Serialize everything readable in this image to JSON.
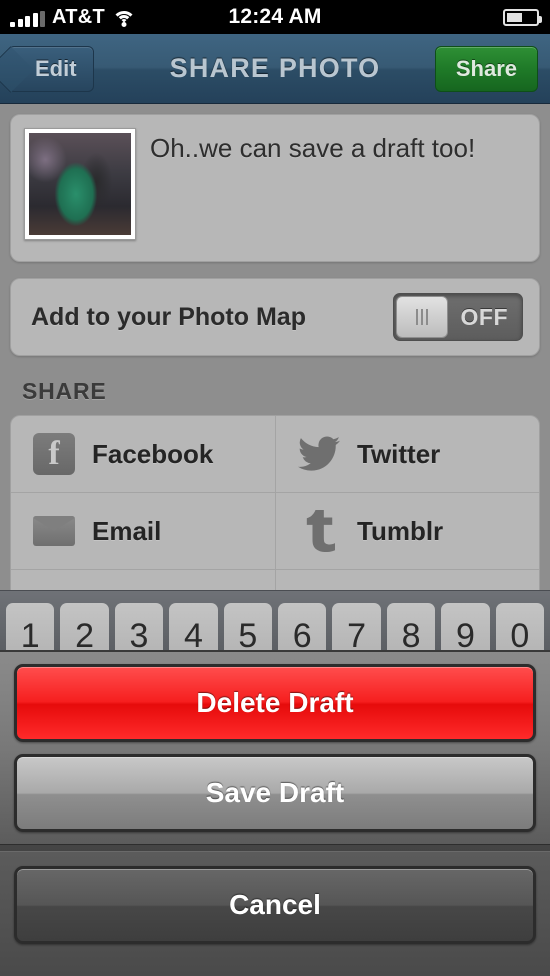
{
  "statusbar": {
    "carrier": "AT&T",
    "time": "12:24 AM",
    "signal_bars_total": 5,
    "signal_bars_filled": 4,
    "wifi_icon": "wifi-icon",
    "battery_icon": "battery-icon",
    "battery_level_percent": 46
  },
  "navbar": {
    "back_label": "Edit",
    "title": "SHARE PHOTO",
    "action_label": "Share",
    "action_color": "#1f7a28",
    "bar_color": "#2c4d66"
  },
  "caption": {
    "text": "Oh..we can save a draft too!",
    "thumbnail_name": "photo-thumbnail"
  },
  "photomap": {
    "label": "Add to your Photo Map",
    "toggle_value": "OFF",
    "toggle_on": false
  },
  "share": {
    "section_title": "SHARE",
    "services": [
      {
        "label": "Facebook",
        "icon": "facebook-icon"
      },
      {
        "label": "Twitter",
        "icon": "twitter-bird-icon"
      },
      {
        "label": "Email",
        "icon": "envelope-icon"
      },
      {
        "label": "Tumblr",
        "icon": "tumblr-icon"
      }
    ]
  },
  "keyboard": {
    "number_row": [
      "1",
      "2",
      "3",
      "4",
      "5",
      "6",
      "7",
      "8",
      "9",
      "0"
    ]
  },
  "action_sheet": {
    "delete_label": "Delete Draft",
    "delete_color": "#f61f1f",
    "save_label": "Save Draft",
    "cancel_label": "Cancel"
  }
}
